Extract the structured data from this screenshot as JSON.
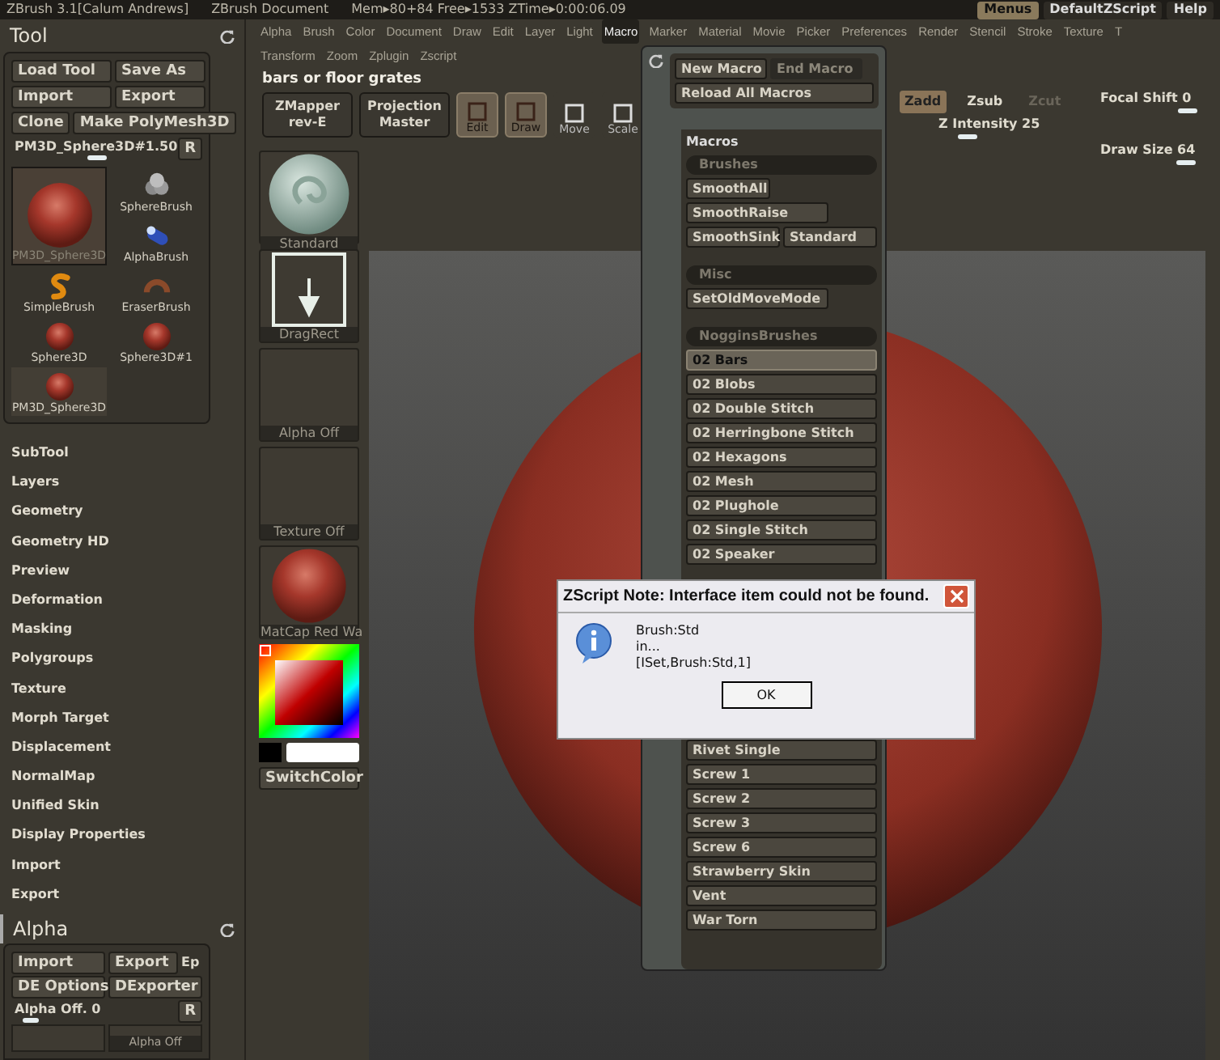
{
  "title_bar": {
    "texts": [
      "ZBrush 3.1[Calum Andrews]",
      "ZBrush Document",
      "Mem▸80+84 Free▸1533 ZTime▸0:00:06.09"
    ],
    "buttons": [
      {
        "label": "Menus",
        "selected": true
      },
      {
        "label": "DefaultZScript",
        "selected": false
      },
      {
        "label": "Help",
        "selected": false
      }
    ]
  },
  "tool_palette": {
    "title": "Tool",
    "buttons": [
      "Load Tool",
      "Save As",
      "Import",
      "Export",
      "Clone",
      "Make PolyMesh3D"
    ],
    "slider": {
      "label": "PM3D_Sphere3D#1.50",
      "level": 0.52,
      "reset": "R"
    },
    "current_tool": {
      "name": "PM3D_Sphere3D",
      "kind": "sphere"
    },
    "tools": [
      {
        "name": "SphereBrush",
        "kind": "cluster"
      },
      {
        "name": "AlphaBrush",
        "kind": "capsule"
      },
      {
        "name": "SimpleBrush",
        "kind": "swirl"
      },
      {
        "name": "EraserBrush",
        "kind": "ring"
      },
      {
        "name": "Sphere3D",
        "kind": "sphere"
      },
      {
        "name": "Sphere3D#1",
        "kind": "sphere"
      },
      {
        "name": "PM3D_Sphere3D",
        "kind": "sphere"
      }
    ],
    "sections": [
      "SubTool",
      "Layers",
      "Geometry",
      "Geometry HD",
      "Preview",
      "Deformation",
      "Masking",
      "Polygroups",
      "Texture",
      "Morph Target",
      "Displacement",
      "NormalMap",
      "Unified Skin",
      "Display Properties",
      "Import",
      "Export"
    ]
  },
  "alpha_palette": {
    "title": "Alpha",
    "buttons": [
      "Import",
      "Export",
      "Ep",
      "DE Options",
      "DExporter"
    ],
    "slider": {
      "label": "Alpha Off.",
      "value": "0",
      "level": 0.08,
      "reset": "R"
    },
    "thumb_label": "Alpha Off"
  },
  "menu_bar": {
    "rows": [
      [
        {
          "label": "Alpha",
          "selected": false
        },
        {
          "label": "Brush",
          "selected": false
        },
        {
          "label": "Color",
          "selected": false
        },
        {
          "label": "Document",
          "selected": false
        },
        {
          "label": "Draw",
          "selected": false
        },
        {
          "label": "Edit",
          "selected": false
        },
        {
          "label": "Layer",
          "selected": false
        },
        {
          "label": "Light",
          "selected": false
        },
        {
          "label": "Macro",
          "selected": true
        },
        {
          "label": "Marker",
          "selected": false
        },
        {
          "label": "Material",
          "selected": false
        },
        {
          "label": "Movie",
          "selected": false
        },
        {
          "label": "Picker",
          "selected": false
        },
        {
          "label": "Preferences",
          "selected": false
        },
        {
          "label": "Render",
          "selected": false
        },
        {
          "label": "Stencil",
          "selected": false
        },
        {
          "label": "Stroke",
          "selected": false
        },
        {
          "label": "Texture",
          "selected": false
        },
        {
          "label": "T",
          "selected": false
        }
      ],
      [
        {
          "label": "Transform",
          "selected": false
        },
        {
          "label": "Zoom",
          "selected": false
        },
        {
          "label": "Zplugin",
          "selected": false
        },
        {
          "label": "Zscript",
          "selected": false
        }
      ]
    ]
  },
  "note": "bars or floor grates",
  "toolbar": {
    "buttons": [
      {
        "kind": "big",
        "label": "ZMapper",
        "sub": "rev-E"
      },
      {
        "kind": "big",
        "label": "Projection",
        "sub": "Master"
      },
      {
        "kind": "tool",
        "label": "Edit",
        "selected": true
      },
      {
        "kind": "tool",
        "label": "Draw",
        "selected": true
      },
      {
        "kind": "tool",
        "label": "Move",
        "selected": false
      },
      {
        "kind": "tool",
        "label": "Scale",
        "selected": false
      }
    ],
    "modes": [
      {
        "label": "Zadd",
        "selected": true,
        "disabled": false
      },
      {
        "label": "Zsub",
        "selected": false,
        "disabled": false
      },
      {
        "label": "Zcut",
        "selected": false,
        "disabled": true
      }
    ],
    "sliders": [
      {
        "label": "Z Intensity 25",
        "level": 0.2
      },
      {
        "label": "Focal Shift 0",
        "level": 0.8
      },
      {
        "label": "Draw Size 64",
        "level": 0.78
      }
    ]
  },
  "shelf": {
    "items": [
      {
        "kind": "material",
        "label": "Standard"
      },
      {
        "kind": "stroke",
        "label": "DragRect"
      },
      {
        "kind": "empty",
        "label": "Alpha Off"
      },
      {
        "kind": "empty",
        "label": "Texture Off"
      },
      {
        "kind": "matcap",
        "label": "MatCap Red Wa"
      }
    ],
    "switch_color": "SwitchColor"
  },
  "macro_menu": {
    "buttons": [
      {
        "label": "New Macro",
        "disabled": false
      },
      {
        "label": "End Macro",
        "disabled": true
      },
      {
        "label": "Reload All Macros",
        "disabled": false
      }
    ],
    "heading": "Macros",
    "groups": [
      {
        "title": "Brushes",
        "items": [
          {
            "label": "SmoothAll",
            "selected": false
          },
          {
            "label": "SmoothRaise",
            "selected": false
          },
          {
            "label": "SmoothSink",
            "selected": false
          },
          {
            "label": "Standard",
            "selected": false
          }
        ]
      },
      {
        "title": "Misc",
        "items": [
          {
            "label": "SetOldMoveMode",
            "selected": false
          }
        ]
      },
      {
        "title": "NogginsBrushes",
        "items": [
          {
            "label": "02 Bars",
            "selected": true
          },
          {
            "label": "02 Blobs",
            "selected": false
          },
          {
            "label": "02 Double Stitch",
            "selected": false
          },
          {
            "label": "02 Herringbone Stitch",
            "selected": false
          },
          {
            "label": "02 Hexagons",
            "selected": false
          },
          {
            "label": "02 Mesh",
            "selected": false
          },
          {
            "label": "02 Plughole",
            "selected": false
          },
          {
            "label": "02 Single Stitch",
            "selected": false
          },
          {
            "label": "02 Speaker",
            "selected": false
          }
        ],
        "items_below_note": [
          {
            "label": "Rivet Single",
            "selected": false
          },
          {
            "label": "Screw 1",
            "selected": false
          },
          {
            "label": "Screw 2",
            "selected": false
          },
          {
            "label": "Screw 3",
            "selected": false
          },
          {
            "label": "Screw 6",
            "selected": false
          },
          {
            "label": "Strawberry Skin",
            "selected": false
          },
          {
            "label": "Vent",
            "selected": false
          },
          {
            "label": "War Torn",
            "selected": false
          }
        ]
      }
    ]
  },
  "dialog": {
    "title": "ZScript Note: Interface item could not be found.",
    "lines": [
      "Brush:Std",
      "in...",
      "[ISet,Brush:Std,1]"
    ],
    "button": "OK"
  }
}
